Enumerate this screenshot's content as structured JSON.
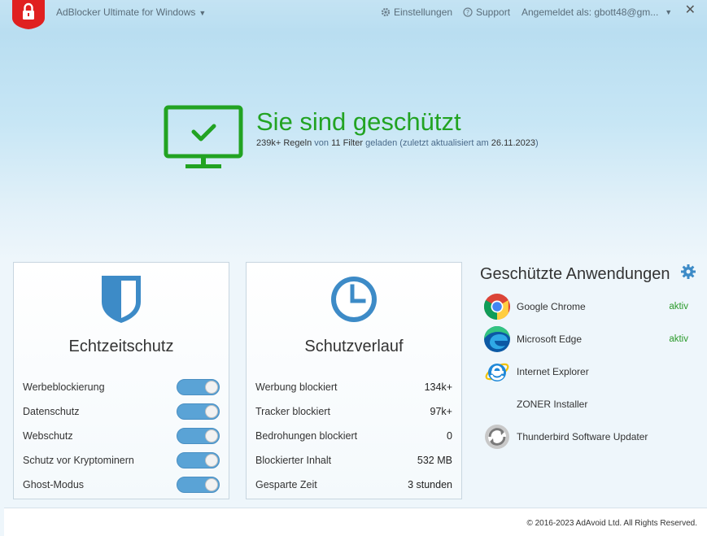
{
  "header": {
    "app_title": "AdBlocker Ultimate for Windows",
    "settings_label": "Einstellungen",
    "support_label": "Support",
    "account_label": "Angemeldet als: gbott48@gm...",
    "close_glyph": "✕"
  },
  "status": {
    "title": "Sie sind geschützt",
    "rules_count": "239k+",
    "rules_word": "Regeln",
    "from_word": "von",
    "filters_count": "11",
    "filters_word": "Filter",
    "loaded_text": "geladen (zuletzt aktualisiert am",
    "date": "26.11.2023",
    "close_paren": ")"
  },
  "realtime": {
    "title": "Echtzeitschutz",
    "items": [
      {
        "label": "Werbeblockierung",
        "enabled": true
      },
      {
        "label": "Datenschutz",
        "enabled": true
      },
      {
        "label": "Webschutz",
        "enabled": true
      },
      {
        "label": "Schutz vor Kryptominern",
        "enabled": true
      },
      {
        "label": "Ghost-Modus",
        "enabled": true
      }
    ]
  },
  "history": {
    "title": "Schutzverlauf",
    "items": [
      {
        "label": "Werbung blockiert",
        "value": "134k+"
      },
      {
        "label": "Tracker blockiert",
        "value": "97k+"
      },
      {
        "label": "Bedrohungen blockiert",
        "value": "0"
      },
      {
        "label": "Blockierter Inhalt",
        "value": "532 MB"
      },
      {
        "label": "Gesparte Zeit",
        "value": "3 stunden"
      }
    ]
  },
  "apps": {
    "title": "Geschützte Anwendungen",
    "items": [
      {
        "name": "Google Chrome",
        "status": "aktiv",
        "icon": "chrome-icon"
      },
      {
        "name": "Microsoft Edge",
        "status": "aktiv",
        "icon": "edge-icon"
      },
      {
        "name": "Internet Explorer",
        "status": "",
        "icon": "ie-icon"
      },
      {
        "name": "ZONER Installer",
        "status": "",
        "icon": ""
      },
      {
        "name": "Thunderbird Software Updater",
        "status": "",
        "icon": "updater-icon"
      }
    ]
  },
  "footer": {
    "copyright": "© 2016-2023 AdAvoid Ltd. All Rights Reserved."
  },
  "colors": {
    "accent_green": "#22a322",
    "toggle_blue": "#5aa3d6",
    "icon_blue": "#3d8bc7",
    "brand_red": "#e02020"
  }
}
